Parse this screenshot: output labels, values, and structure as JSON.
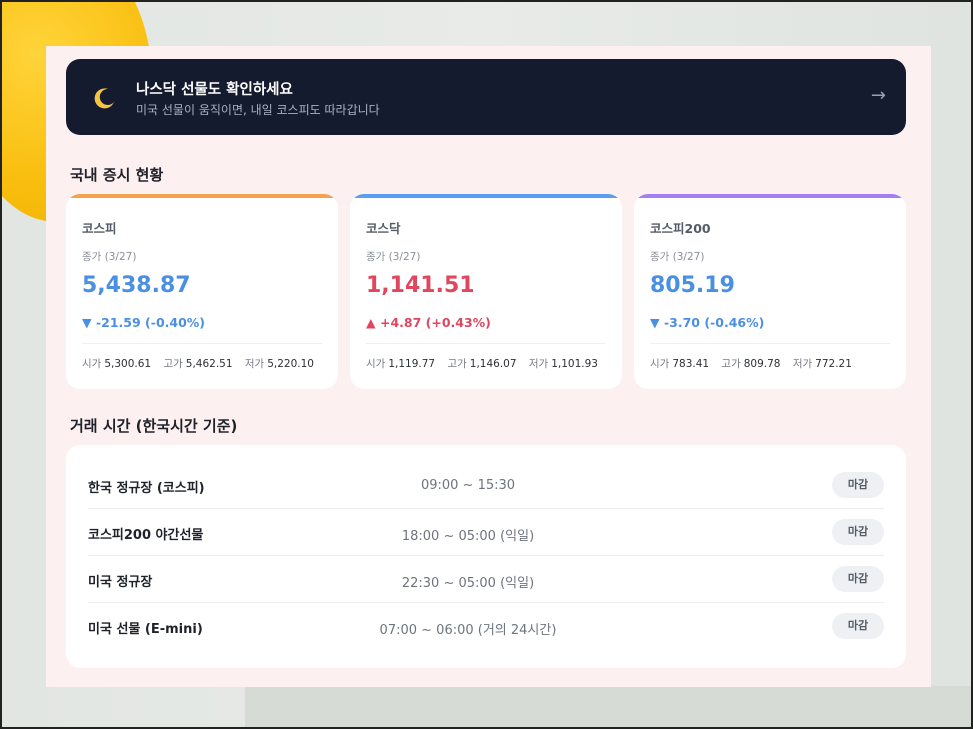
{
  "banner": {
    "icon": "moon-icon",
    "title": "나스닥 선물도 확인하세요",
    "subtitle": "미국 선물이 움직이면, 내일 코스피도 따라갑니다",
    "arrow": "→"
  },
  "market_section": {
    "title": "국내 증시 현황"
  },
  "cards": [
    {
      "name": "코스피",
      "date": "종가 (3/27)",
      "price": "5,438.87",
      "change": "▼ -21.59 (-0.40%)",
      "direction": "down",
      "accent": "#f5a04a",
      "open_label": "시가",
      "open": "5,300.61",
      "high_label": "고가",
      "high": "5,462.51",
      "low_label": "저가",
      "low": "5,220.10"
    },
    {
      "name": "코스닥",
      "date": "종가 (3/27)",
      "price": "1,141.51",
      "change": "▲ +4.87 (+0.43%)",
      "direction": "up",
      "accent": "#5b9def",
      "open_label": "시가",
      "open": "1,119.77",
      "high_label": "고가",
      "high": "1,146.07",
      "low_label": "저가",
      "low": "1,101.93"
    },
    {
      "name": "코스피200",
      "date": "종가 (3/27)",
      "price": "805.19",
      "change": "▼ -3.70 (-0.46%)",
      "direction": "down",
      "accent": "#a77ef0",
      "open_label": "시가",
      "open": "783.41",
      "high_label": "고가",
      "high": "809.78",
      "low_label": "저가",
      "low": "772.21"
    }
  ],
  "hours_section": {
    "title": "거래 시간 (한국시간 기준)"
  },
  "hours": [
    {
      "name": "한국 정규장 (코스피)",
      "time": "09:00 ~ 15:30",
      "status": "마감"
    },
    {
      "name": "코스피200 야간선물",
      "time": "18:00 ~ 05:00 (익일)",
      "status": "마감"
    },
    {
      "name": "미국 정규장",
      "time": "22:30 ~ 05:00 (익일)",
      "status": "마감"
    },
    {
      "name": "미국 선물 (E-mini)",
      "time": "07:00 ~ 06:00 (거의 24시간)",
      "status": "마감"
    }
  ],
  "colors": {
    "down": "#4a90e2",
    "up": "#e0475e",
    "banner_bg": "#141b2e"
  }
}
